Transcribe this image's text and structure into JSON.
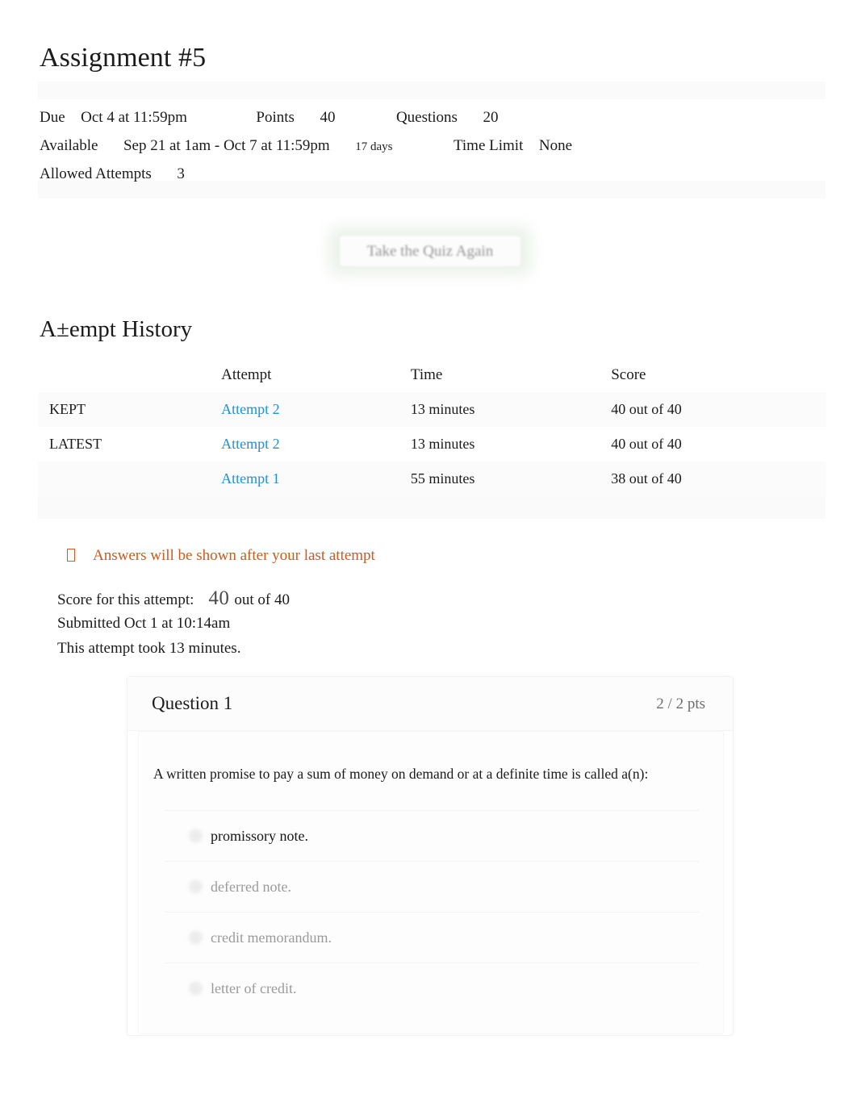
{
  "quiz": {
    "title": "Assignment #5",
    "details": {
      "due_label": "Due",
      "due_value": "Oct 4 at 11:59pm",
      "points_label": "Points",
      "points_value": "40",
      "questions_label": "Questions",
      "questions_value": "20",
      "available_label": "Available",
      "available_value": "Sep 21 at 1am - Oct 7 at 11:59pm",
      "duration_note": "17 days",
      "time_limit_label": "Time Limit",
      "time_limit_value": "None",
      "allowed_attempts_label": "Allowed Attempts",
      "allowed_attempts_value": "3"
    },
    "retake_button_label": "Take the Quiz Again"
  },
  "history": {
    "heading": "A±empt History",
    "columns": {
      "status": "",
      "attempt": "Attempt",
      "time": "Time",
      "score": "Score"
    },
    "rows": [
      {
        "status": "KEPT",
        "attempt": "Attempt 2",
        "time": "13 minutes",
        "score": "40 out of 40"
      },
      {
        "status": "LATEST",
        "attempt": "Attempt 2",
        "time": "13 minutes",
        "score": "40 out of 40"
      },
      {
        "status": "",
        "attempt": "Attempt 1",
        "time": "55 minutes",
        "score": "38 out of 40"
      }
    ]
  },
  "notice": {
    "icon": "warning-icon",
    "text": "Answers will be shown after your last attempt",
    "color": "#cc5a21"
  },
  "summary": {
    "score_label": "Score for this attempt:",
    "score_value": "40",
    "score_out_of": "out of 40",
    "submitted": "Submitted Oct 1 at 10:14am",
    "duration": "This attempt took 13 minutes."
  },
  "question": {
    "title": "Question 1",
    "points": "2 / 2 pts",
    "text": "A written promise to pay a sum of money on demand or at a definite time is called a(n):",
    "options": [
      {
        "label": "promissory note.",
        "selected": true
      },
      {
        "label": "deferred note.",
        "selected": false
      },
      {
        "label": "credit memorandum.",
        "selected": false
      },
      {
        "label": "letter of credit.",
        "selected": false
      }
    ]
  },
  "colors": {
    "link": "#1f90d8",
    "notice": "#cc5a21",
    "text": "#1b1b1b",
    "muted": "#9a9a9a"
  }
}
